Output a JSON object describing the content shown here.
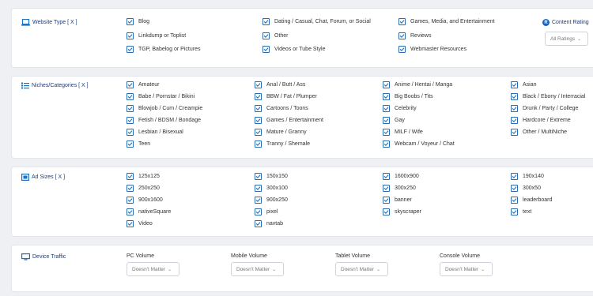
{
  "website_type": {
    "title": "Website Type [ X ]",
    "columns": [
      [
        "Blog",
        "Linkdump or Toplist",
        "TGP, Babelog or Pictures"
      ],
      [
        "Dating / Casual, Chat, Forum, or Social",
        "Other",
        "Videos or Tube Style"
      ],
      [
        "Games, Media, and Entertainment",
        "Reviews",
        "Webmaster Resources"
      ]
    ],
    "rating": {
      "badge": "R",
      "label": "Content Rating",
      "select": "All Ratings"
    }
  },
  "niches": {
    "title": "Niches/Categories [ X ]",
    "columns": [
      [
        "Amateur",
        "Babe / Pornstar / Bikini",
        "Blowjob / Cum / Creampie",
        "Fetish / BDSM / Bondage",
        "Lesbian / Bisexual",
        "Teen"
      ],
      [
        "Anal / Butt / Ass",
        "BBW / Fat / Plumper",
        "Cartoons / Toons",
        "Games / Entertainment",
        "Mature / Granny",
        "Tranny / Shemale"
      ],
      [
        "Anime / Hentai / Manga",
        "Big Boobs / Tits",
        "Celebrity",
        "Gay",
        "MILF / Wife",
        "Webcam / Voyeur / Chat"
      ],
      [
        "Asian",
        "Black / Ebony / Interracial",
        "Drunk / Party / College",
        "Hardcore / Extreme",
        "Other / MultiNiche"
      ]
    ]
  },
  "ad_sizes": {
    "title": "Ad Sizes [ X ]",
    "columns": [
      [
        "125x125",
        "250x250",
        "900x1600",
        "nativeSquare",
        "Video"
      ],
      [
        "150x150",
        "300x100",
        "900x250",
        "pixel",
        "navtab"
      ],
      [
        "1600x900",
        "300x250",
        "banner",
        "skyscraper"
      ],
      [
        "190x140",
        "300x50",
        "leaderboard",
        "text"
      ]
    ]
  },
  "device_traffic": {
    "title": "Device Traffic",
    "volumes": [
      {
        "label": "PC Volume",
        "value": "Doesn't Matter"
      },
      {
        "label": "Mobile Volume",
        "value": "Doesn't Matter"
      },
      {
        "label": "Tablet Volume",
        "value": "Doesn't Matter"
      },
      {
        "label": "Console Volume",
        "value": "Doesn't Matter"
      }
    ]
  },
  "icons": {
    "website_type": "laptop-icon",
    "niches": "list-icon",
    "ad_sizes": "ad-icon",
    "device": "monitor-icon"
  },
  "colors": {
    "accent": "#2b6cb0",
    "title": "#1e3a78",
    "badge": "#1a63b8"
  }
}
